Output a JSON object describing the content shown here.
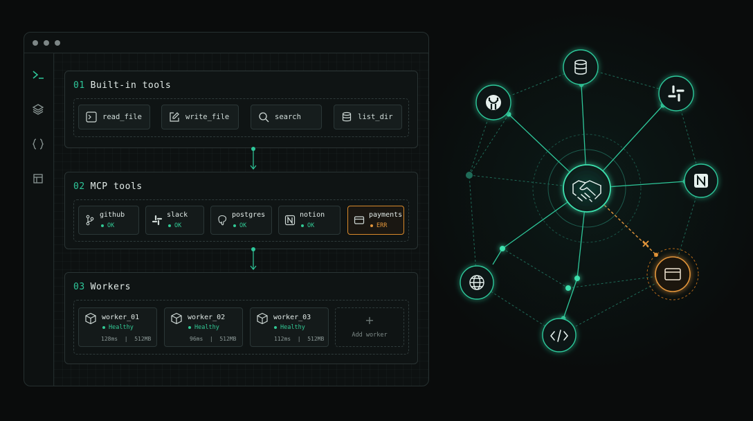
{
  "window": {
    "traffic_lights": [
      "dot",
      "dot",
      "dot"
    ],
    "sidebar": [
      {
        "icon": "terminal-icon"
      },
      {
        "icon": "layers-icon"
      },
      {
        "icon": "braces-icon"
      },
      {
        "icon": "layout-icon"
      }
    ]
  },
  "sections": {
    "builtin": {
      "number": "01",
      "title": "Built-in tools",
      "tools": [
        {
          "label": "read_file",
          "icon": "terminal-icon"
        },
        {
          "label": "write_file",
          "icon": "edit-icon"
        },
        {
          "label": "search",
          "icon": "search-icon"
        },
        {
          "label": "list_dir",
          "icon": "database-icon"
        }
      ]
    },
    "mcp": {
      "number": "02",
      "title": "MCP tools",
      "tools": [
        {
          "name": "github",
          "status": "OK",
          "icon": "git-branch-icon"
        },
        {
          "name": "slack",
          "status": "OK",
          "icon": "slack-icon"
        },
        {
          "name": "postgres",
          "status": "OK",
          "icon": "postgres-icon"
        },
        {
          "name": "notion",
          "status": "OK",
          "icon": "notion-icon"
        },
        {
          "name": "payments",
          "status": "ERR",
          "icon": "credit-card-icon"
        }
      ]
    },
    "workers": {
      "number": "03",
      "title": "Workers",
      "items": [
        {
          "name": "worker_01",
          "status": "Healthy",
          "latency": "128ms",
          "memory": "512MB"
        },
        {
          "name": "worker_02",
          "status": "Healthy",
          "latency": "96ms",
          "memory": "512MB"
        },
        {
          "name": "worker_03",
          "status": "Healthy",
          "latency": "112ms",
          "memory": "512MB"
        }
      ],
      "add_label": "Add worker",
      "add_symbol": "+"
    }
  },
  "colors": {
    "accent": "#2ec79a",
    "error": "#e3963b",
    "background": "#0a0c0c"
  },
  "network": {
    "hub_icon": "handshake-icon",
    "nodes": [
      {
        "icon": "database-icon",
        "status": "connected"
      },
      {
        "icon": "github-icon",
        "status": "connected"
      },
      {
        "icon": "slack-icon",
        "status": "connected"
      },
      {
        "icon": "notion-icon",
        "status": "connected"
      },
      {
        "icon": "globe-icon",
        "status": "connected"
      },
      {
        "icon": "code-icon",
        "status": "connected"
      },
      {
        "icon": "credit-card-icon",
        "status": "error"
      }
    ]
  }
}
